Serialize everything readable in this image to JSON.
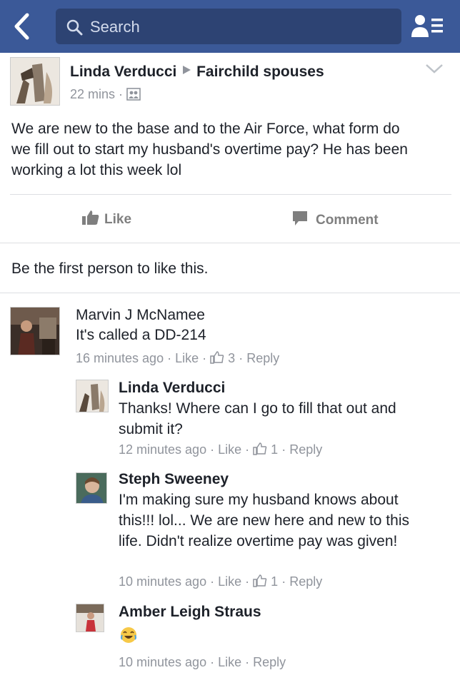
{
  "header": {
    "search_placeholder": "Search"
  },
  "post": {
    "author": "Linda Verducci",
    "group": "Fairchild spouses",
    "time": "22 mins",
    "text": "We are new to the base and to the Air Force, what form do we fill out to start my husband's overtime pay? He has been working a lot this week lol",
    "like_label": "Like",
    "comment_label": "Comment",
    "likes_summary": "Be the first person to like this."
  },
  "comments": [
    {
      "name": "Marvin J McNamee",
      "text": "It's called a DD-214",
      "time": "16 minutes ago",
      "like": "Like",
      "count": "3",
      "reply": "Reply"
    },
    {
      "name": "Linda Verducci",
      "text": "Thanks! Where can I go to fill that out and submit it?",
      "time": "12 minutes ago",
      "like": "Like",
      "count": "1",
      "reply": "Reply"
    },
    {
      "name": "Steph Sweeney",
      "text": "I'm making sure my husband knows about this!!! lol... We are new here and new to this life. Didn't realize overtime pay was given!",
      "time": "10 minutes ago",
      "like": "Like",
      "count": "1",
      "reply": "Reply"
    },
    {
      "name": "Amber Leigh Straus",
      "text": "",
      "time": "10 minutes ago",
      "like": "Like",
      "reply": "Reply"
    }
  ],
  "icons": {
    "back": "chevron-left-icon",
    "search": "search-icon",
    "friends": "friend-requests-icon",
    "menu": "chevron-down-icon",
    "privacy": "group-privacy-icon",
    "like": "thumbs-up-icon",
    "comment": "comment-icon",
    "emoji": "laughing-emoji-icon"
  },
  "colors": {
    "brand": "#3b5998",
    "search_bg": "#2d4373",
    "meta": "#90949c",
    "text": "#1d2129"
  }
}
